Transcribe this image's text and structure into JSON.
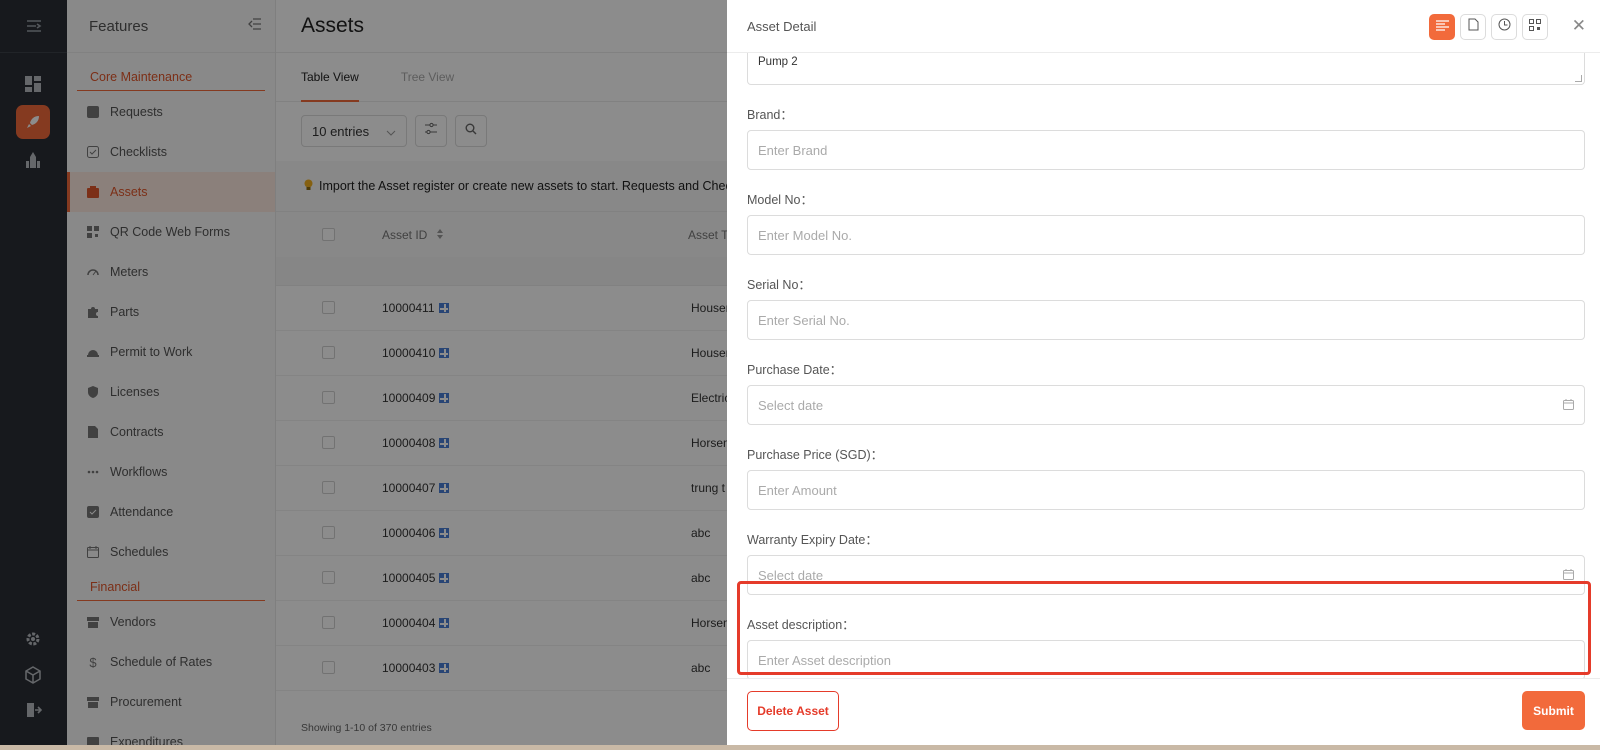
{
  "rail": {
    "items": [
      "menu-toggle-icon",
      "dashboard-icon",
      "rocket-icon",
      "reports-icon",
      "settings-icon",
      "box-icon",
      "logout-icon"
    ]
  },
  "features": {
    "title": "Features",
    "sections": [
      {
        "title": "Core Maintenance"
      },
      {
        "title": "Financial"
      }
    ],
    "core_items": [
      "Requests",
      "Checklists",
      "Assets",
      "QR Code Web Forms",
      "Meters",
      "Parts",
      "Permit to Work",
      "Licenses",
      "Contracts",
      "Workflows",
      "Attendance",
      "Schedules"
    ],
    "financial_items": [
      "Vendors",
      "Schedule of Rates",
      "Procurement",
      "Expenditures"
    ]
  },
  "main": {
    "title": "Assets",
    "tabs": [
      "Table View",
      "Tree View"
    ],
    "entries": "10 entries",
    "notice": "Import the Asset register or create new assets to start. Requests and Checklists",
    "columns": [
      "Asset ID",
      "Asset Ty"
    ],
    "rows": [
      {
        "id": "10000411",
        "type": "Housem"
      },
      {
        "id": "10000410",
        "type": "Housem"
      },
      {
        "id": "10000409",
        "type": "Electric"
      },
      {
        "id": "10000408",
        "type": "Horsem"
      },
      {
        "id": "10000407",
        "type": "trung t"
      },
      {
        "id": "10000406",
        "type": "abc"
      },
      {
        "id": "10000405",
        "type": "abc"
      },
      {
        "id": "10000404",
        "type": "Horsem"
      },
      {
        "id": "10000403",
        "type": "abc"
      }
    ],
    "showing": "Showing 1-10 of 370 entries"
  },
  "drawer": {
    "title": "Asset Detail",
    "name_value": "Pump 2",
    "fields": [
      {
        "label": "Brand：",
        "placeholder": "Enter Brand"
      },
      {
        "label": "Model No：",
        "placeholder": "Enter Model No."
      },
      {
        "label": "Serial No：",
        "placeholder": "Enter Serial No."
      },
      {
        "label": "Purchase Date：",
        "placeholder": "Select date"
      },
      {
        "label": "Purchase Price (SGD)：",
        "placeholder": "Enter Amount"
      },
      {
        "label": "Warranty Expiry Date：",
        "placeholder": "Select date"
      },
      {
        "label": "Asset description：",
        "placeholder": "Enter Asset description"
      }
    ],
    "delete_label": "Delete Asset",
    "submit_label": "Submit"
  },
  "colors": {
    "accent": "#f26a3b",
    "highlight": "#e53b2a",
    "rail": "#2b2f36"
  }
}
